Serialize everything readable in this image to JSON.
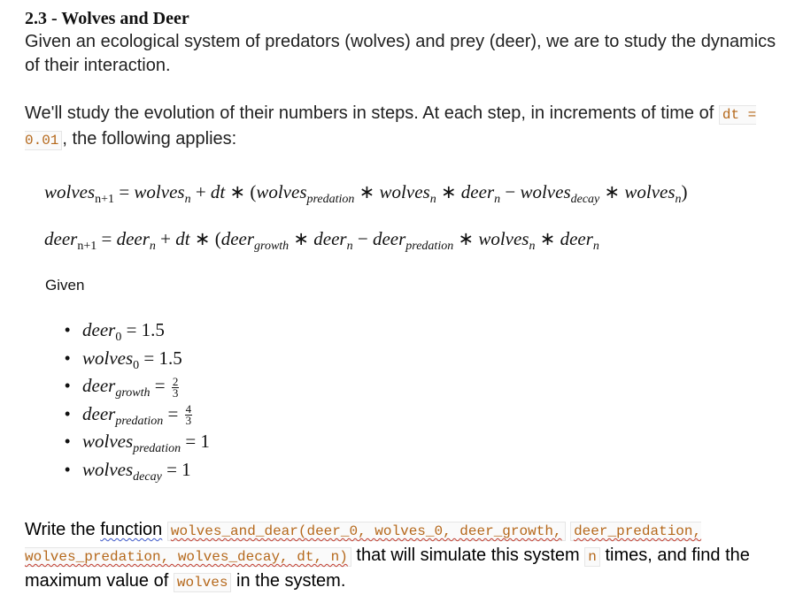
{
  "heading": "2.3 - Wolves and Deer",
  "intro": "Given an ecological system of predators (wolves) and prey (deer), we are to study the dynamics of their interaction.",
  "steps_text_before": "We'll study the evolution of their numbers in steps. At each step, in increments of time of ",
  "steps_code": "dt = 0.01",
  "steps_text_after": ", the following applies:",
  "equation_1": {
    "lhs_var": "wolves",
    "lhs_sub": "n+1",
    "t1_var": "wolves",
    "t1_sub": "n",
    "dt": "dt",
    "p1_var": "wolves",
    "p1_sub": "predation",
    "p2_var": "wolves",
    "p2_sub": "n",
    "p3_var": "deer",
    "p3_sub": "n",
    "m1_var": "wolves",
    "m1_sub": "decay",
    "m2_var": "wolves",
    "m2_sub": "n"
  },
  "equation_2": {
    "lhs_var": "deer",
    "lhs_sub": "n+1",
    "t1_var": "deer",
    "t1_sub": "n",
    "dt": "dt",
    "p1_var": "deer",
    "p1_sub": "growth",
    "p2_var": "deer",
    "p2_sub": "n",
    "m1_var": "deer",
    "m1_sub": "predation",
    "m2_var": "wolves",
    "m2_sub": "n",
    "m3_var": "deer",
    "m3_sub": "n"
  },
  "given_label": "Given",
  "given_items": [
    {
      "var": "deer",
      "sub": "0",
      "value": "1.5"
    },
    {
      "var": "wolves",
      "sub": "0",
      "value": "1.5"
    },
    {
      "var": "deer",
      "sub": "growth",
      "num": "2",
      "den": "3"
    },
    {
      "var": "deer",
      "sub": "predation",
      "num": "4",
      "den": "3"
    },
    {
      "var": "wolves",
      "sub": "predation",
      "value": "1"
    },
    {
      "var": "wolves",
      "sub": "decay",
      "value": "1"
    }
  ],
  "task": {
    "text_1": "Write the ",
    "text_2": "function",
    "code_1": "wolves_and_dear(deer_0, wolves_0, deer_growth,",
    "code_2": "deer_predation, wolves_predation, wolves_decay, dt, n)",
    "text_3": " that will simulate this system ",
    "code_3": "n",
    "text_4": " times, and find the maximum value of ",
    "code_4": "wolves",
    "text_5": " in the system."
  }
}
